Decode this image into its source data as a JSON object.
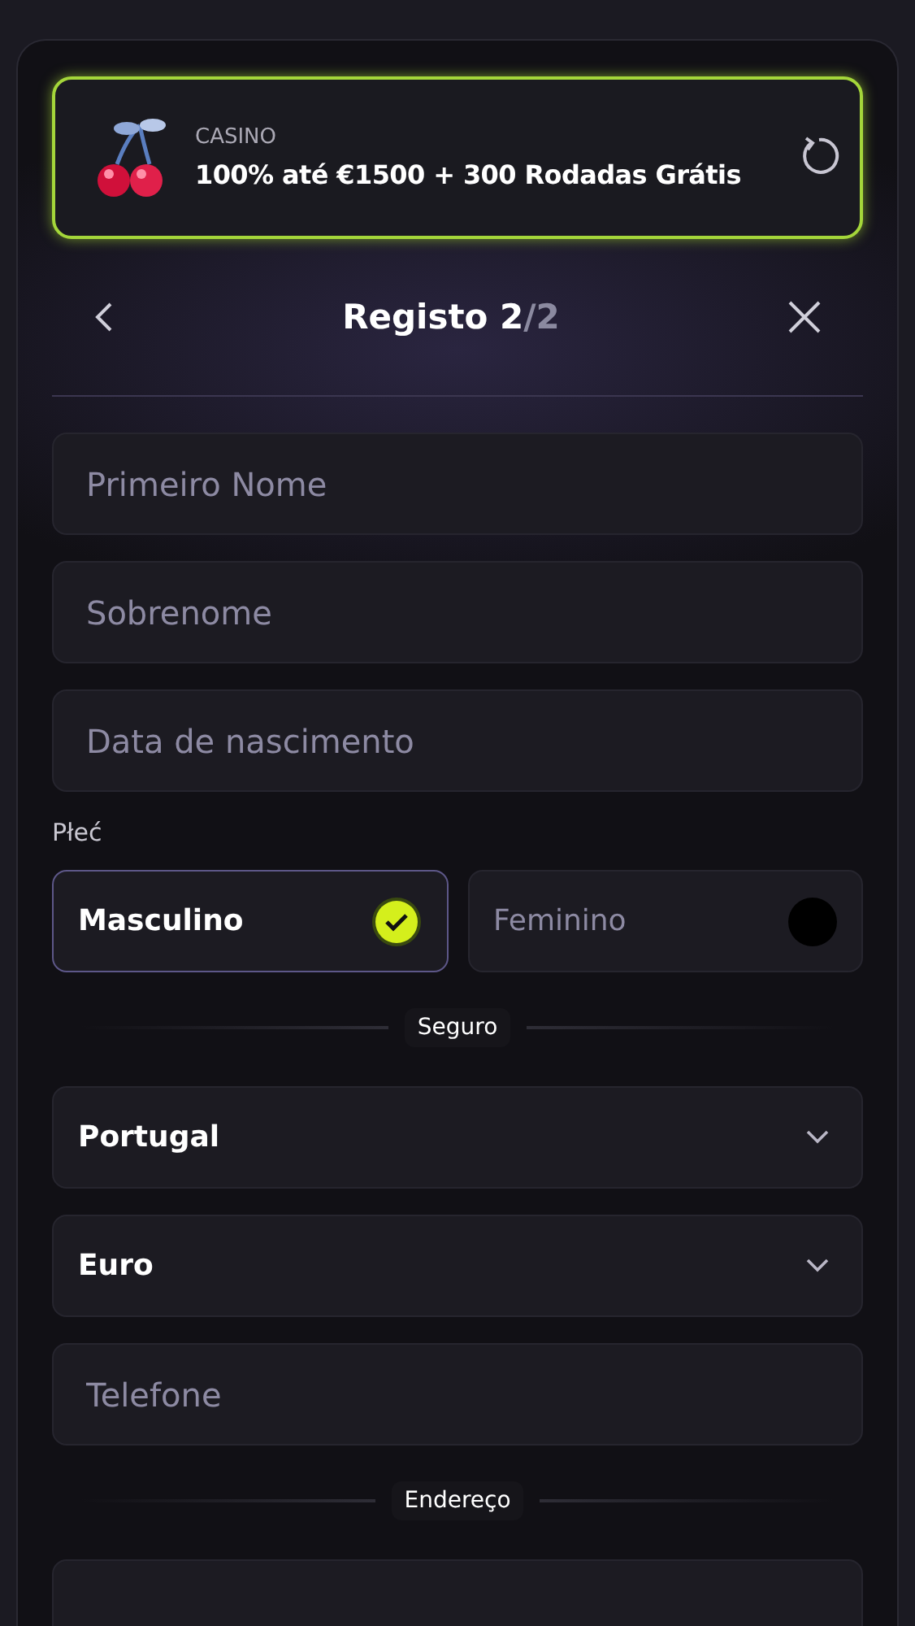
{
  "promo": {
    "category": "CASINO",
    "offer": "100% até €1500 + 300 Rodadas Grátis"
  },
  "header": {
    "title": "Registo 2",
    "step_total": "/2"
  },
  "personal_fields": [
    {
      "kind": "text",
      "placeholder": "Primeiro Nome"
    },
    {
      "kind": "text",
      "placeholder": "Sobrenome"
    },
    {
      "kind": "text",
      "placeholder": "Data de nascimento"
    }
  ],
  "gender": {
    "label": "Płeć",
    "options": [
      {
        "label": "Masculino",
        "selected": true
      },
      {
        "label": "Feminino",
        "selected": false
      }
    ]
  },
  "security_section": {
    "title": "Seguro"
  },
  "account_fields": [
    {
      "kind": "select",
      "value": "Portugal"
    },
    {
      "kind": "select",
      "value": "Euro"
    },
    {
      "kind": "text",
      "placeholder": "Telefone"
    }
  ],
  "address_section": {
    "title": "Endereço"
  },
  "address_fields": [
    {
      "kind": "text"
    }
  ]
}
